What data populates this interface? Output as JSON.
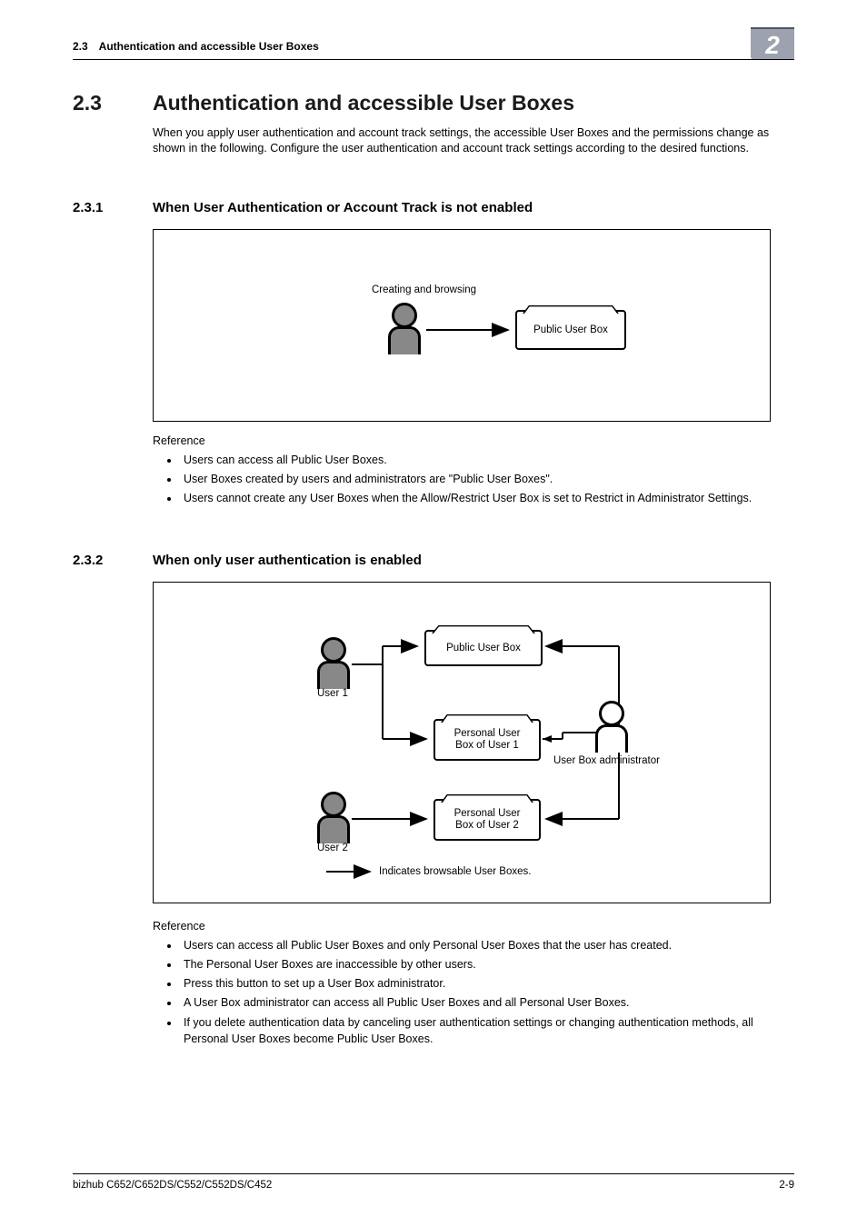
{
  "header": {
    "breadcrumb": "2.3 Authentication and accessible User Boxes",
    "badge": "2"
  },
  "section": {
    "num": "2.3",
    "title": "Authentication and accessible User Boxes",
    "intro": "When you apply user authentication and account track settings, the accessible User Boxes and the permissions change as shown in the following. Configure the user authentication and account track settings according to the desired functions."
  },
  "sub1": {
    "num": "2.3.1",
    "title": "When User Authentication or Account Track is not enabled",
    "diagram": {
      "caption": "Creating and browsing",
      "box": "Public User Box"
    },
    "ref_label": "Reference",
    "refs": [
      "Users can access all Public User Boxes.",
      "User Boxes created by users and administrators are \"Public User Boxes\".",
      "Users cannot create any User Boxes when the Allow/Restrict User Box is set to Restrict in Administrator Settings."
    ]
  },
  "sub2": {
    "num": "2.3.2",
    "title": "When only user authentication is enabled",
    "diagram": {
      "user1": "User 1",
      "user2": "User 2",
      "box_public": "Public User Box",
      "box_personal1_l1": "Personal User",
      "box_personal1_l2": "Box of User 1",
      "box_personal2_l1": "Personal User",
      "box_personal2_l2": "Box of User 2",
      "admin": "User Box administrator",
      "legend": "Indicates browsable User Boxes."
    },
    "ref_label": "Reference",
    "refs": [
      "Users can access all Public User Boxes and only Personal User Boxes that the user has created.",
      "The Personal User Boxes are inaccessible by other users.",
      "Press this button to set up a User Box administrator.",
      "A User Box administrator can access all Public User Boxes and all Personal User Boxes.",
      "If you delete authentication data by canceling user authentication settings or changing authentication methods, all Personal User Boxes become Public User Boxes."
    ]
  },
  "footer": {
    "left": "bizhub C652/C652DS/C552/C552DS/C452",
    "right": "2-9"
  }
}
